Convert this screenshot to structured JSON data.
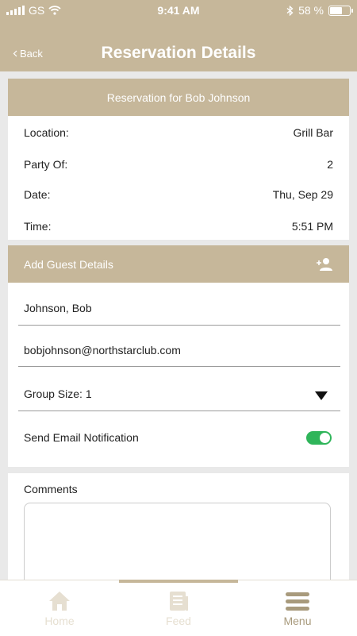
{
  "status_bar": {
    "carrier": "GS",
    "time": "9:41 AM",
    "battery": "58 %",
    "battery_level": 0.58
  },
  "nav": {
    "back_label": "Back",
    "title": "Reservation Details"
  },
  "reservation": {
    "header": "Reservation for Bob Johnson",
    "rows": [
      {
        "label": "Location:",
        "value": "Grill Bar"
      },
      {
        "label": "Party Of:",
        "value": "2"
      },
      {
        "label": "Date:",
        "value": "Thu, Sep 29"
      },
      {
        "label": "Time:",
        "value": "5:51 PM"
      }
    ]
  },
  "guest": {
    "header": "Add Guest Details",
    "name": "Johnson, Bob",
    "email": "bobjohnson@northstarclub.com",
    "group_size": "Group Size: 1",
    "notification_label": "Send Email Notification",
    "notification_on": true
  },
  "comments": {
    "label": "Comments",
    "value": ""
  },
  "tabs": [
    {
      "label": "Home",
      "icon": "home-icon",
      "active": false
    },
    {
      "label": "Feed",
      "icon": "feed-icon",
      "active": false
    },
    {
      "label": "Menu",
      "icon": "menu-icon",
      "active": true
    }
  ],
  "colors": {
    "accent": "#c6b79a",
    "toggle_on": "#2fb55a",
    "tab_active": "#a89a7c",
    "tab_inactive": "#e6dfd1"
  }
}
